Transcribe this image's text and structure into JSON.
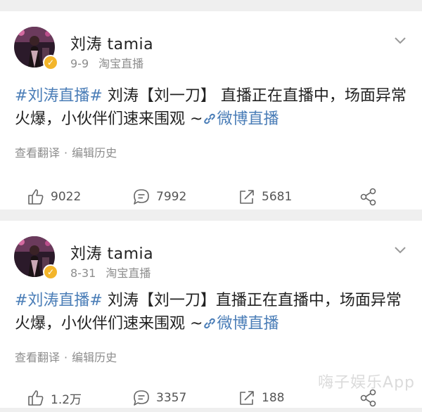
{
  "posts": [
    {
      "author": "刘涛 tamia",
      "date": "9-9",
      "source": "淘宝直播",
      "hashtag": "#刘涛直播#",
      "text_main": " 刘涛【刘一刀】 直播正在直播中，场面异常火爆，小伙伴们速来围观 ~",
      "link_text": "微博直播",
      "translate_label": "查看翻译",
      "separator": "·",
      "edit_history_label": "编辑历史",
      "likes": "9022",
      "comments": "7992",
      "reposts": "5681"
    },
    {
      "author": "刘涛 tamia",
      "date": "8-31",
      "source": "淘宝直播",
      "hashtag": "#刘涛直播#",
      "text_main": " 刘涛【刘一刀】直播正在直播中，场面异常火爆，小伙伴们速来围观 ~",
      "link_text": "微博直播",
      "translate_label": "查看翻译",
      "separator": "·",
      "edit_history_label": "编辑历史",
      "likes": "1.2万",
      "comments": "3357",
      "reposts": "188"
    }
  ],
  "watermark": "嗨子娱乐App",
  "colors": {
    "link": "#4a7db7",
    "verified_badge": "#f3b52b",
    "meta_text": "#8d8d8d",
    "background": "#efefef"
  },
  "icons": [
    "avatar",
    "verified-icon",
    "chevron-down-icon",
    "like-icon",
    "comment-icon",
    "repost-icon",
    "share-icon",
    "link-icon"
  ]
}
